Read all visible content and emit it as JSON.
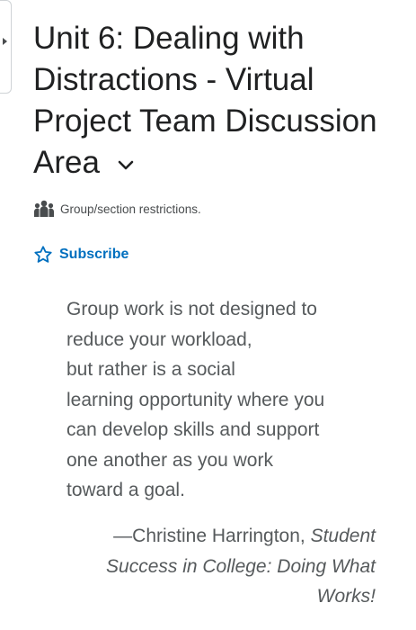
{
  "header": {
    "title": "Unit 6: Dealing with Distractions - Virtual Project Team Discussion Area"
  },
  "restrictions": {
    "label": "Group/section restrictions."
  },
  "subscribe": {
    "label": "Subscribe"
  },
  "quote": {
    "lines": [
      "Group work is not designed to",
      "reduce your workload,",
      "but rather is a social",
      "learning opportunity where you",
      "can develop skills and support",
      "one another as you work",
      "toward a goal."
    ],
    "author": "—Christine Harrington, ",
    "book": "Student Success in College: Doing What Works!"
  },
  "colors": {
    "link": "#006fbf",
    "text": "#565a5c",
    "title": "#202122"
  },
  "icons": {
    "side_toggle": "caret-right-icon",
    "title_menu": "chevron-down-icon",
    "restrictions": "group-icon",
    "subscribe": "star-outline-icon"
  }
}
